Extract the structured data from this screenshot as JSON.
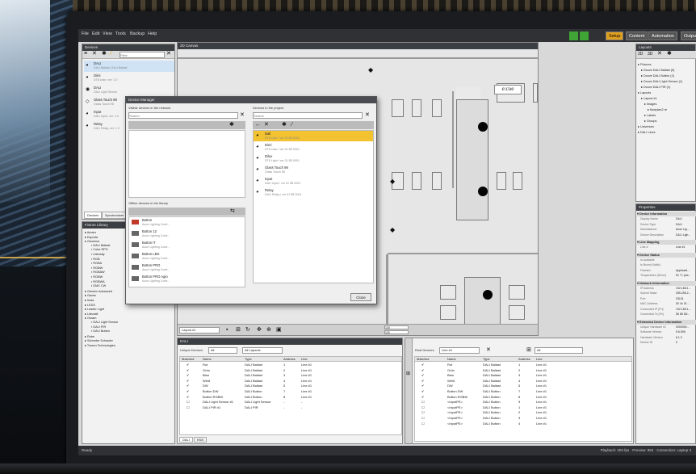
{
  "menu": [
    "File",
    "Edit",
    "View",
    "Tools",
    "Backup",
    "Help"
  ],
  "main_tabs": [
    "Setup",
    "Content",
    "Automation",
    "Output"
  ],
  "devices_panel": {
    "title": "Devices",
    "search_placeholder": "Filter",
    "items": [
      {
        "name": "DALI",
        "sub": "DALI Ballast, DALI Ballast"
      },
      {
        "name": "Dimi",
        "sub": "DT8 color, ver: 1.0"
      },
      {
        "name": "DALI",
        "sub": "DALI Light Sensor"
      },
      {
        "name": "Glass Touch 98",
        "sub": "Glass Touch 98"
      },
      {
        "name": "Input",
        "sub": "DALI Input, ver: 1.0"
      },
      {
        "name": "Relay",
        "sub": "DALI Relay, ver: 1.0"
      }
    ],
    "count": "5 of 5 sel",
    "tabs": [
      "Devices",
      "Synchronizer"
    ]
  },
  "fixture_library": {
    "title": "Fixture Library",
    "items": [
      "Amaru",
      "Esporta",
      "Generics",
      "DALI Ballast",
      "Color RPG",
      "Intensity",
      "RGB",
      "RGBA",
      "RGBW",
      "RGBAW",
      "RGBW",
      "RGBWA",
      "DMX CW",
      "Generic Advanced",
      "Gaxes",
      "Insta",
      "LEDS",
      "Leader Light",
      "Litecraft",
      "Osram",
      "DALI Light Sensor",
      "DALI PIR",
      "DALI Button",
      "Robe",
      "Schreder Schrader",
      "Traxon Technologies"
    ]
  },
  "canvas": {
    "title": "2D Canvas",
    "brand_label": "e:cue",
    "layout_select": "Layout #1",
    "zoom_a": "100",
    "zoom_b": "100"
  },
  "device_manager": {
    "title": "Device Manager",
    "visible_label": "Visible devices in the network",
    "project_label": "Devices in the project",
    "search_placeholder": "Search",
    "project_items": [
      {
        "name": "Dali",
        "sub": "DT8 color / ver 01 5B 0001"
      },
      {
        "name": "Dimi",
        "sub": "DT8 color / ver 01 5B 0001"
      },
      {
        "name": "Dilux",
        "sub": "DT8 Light / ver 01 5B 0001"
      },
      {
        "name": "Glass Touch 98",
        "sub": "Glass Touch 98"
      },
      {
        "name": "Input",
        "sub": "DALI Input / ver 01 5B 0001"
      },
      {
        "name": "Relay",
        "sub": "DALI Relay / ver 01 5B 0001"
      }
    ],
    "offline_label": "Offline devices in the library",
    "offline_items": [
      {
        "name": "Button",
        "sub": "Acue Lighting Contr..."
      },
      {
        "name": "Button 12",
        "sub": "Acue Lighting Contr..."
      },
      {
        "name": "Button IT",
        "sub": "Acue Lighting Contr..."
      },
      {
        "name": "Button LED",
        "sub": "Acue Lighting Contr..."
      },
      {
        "name": "Button PRO",
        "sub": "Acue Lighting Contr..."
      },
      {
        "name": "Button PRO Agio",
        "sub": "Acue Lighting Contr..."
      }
    ],
    "close_label": "Close"
  },
  "layouts_panel": {
    "title": "Layouts",
    "items": [
      "Fixtures",
      "Dcove DALI Ballast (5)",
      "Dcove DALI Button (2)",
      "Dcove DALI Light Sensor (1)",
      "Dcove DALI PIR (1)",
      "Layouts",
      "Layout #1",
      "Images",
      "floorplan2.re",
      "Labels",
      "Groups",
      "Universes",
      "DALI Lines"
    ]
  },
  "properties": {
    "title": "Properties",
    "sections": [
      {
        "header": "Device Information",
        "rows": [
          [
            "Display Name",
            "DALI"
          ],
          [
            "Device Type",
            "DALI"
          ],
          [
            "Manufacturer",
            "Acue Lig..."
          ],
          [
            "Device Description",
            "DALI Ligh..."
          ]
        ]
      },
      {
        "header": "Line Mapping",
        "rows": [
          [
            "Line #",
            "Line #1"
          ]
        ]
      },
      {
        "header": "Device Status",
        "rows": [
          [
            "Is Available",
            ""
          ],
          [
            "Is Bound (Valid)",
            ""
          ],
          [
            "Flashed",
            "Applicabl..."
          ],
          [
            "Temperature (Driver)",
            "51 °C (wa..."
          ]
        ]
      },
      {
        "header": "Network Information",
        "rows": [
          [
            "IP Address",
            "192.168.1..."
          ],
          [
            "Subnet Mask",
            "255.255.2..."
          ],
          [
            "Port",
            "33101"
          ],
          [
            "MAC Address",
            "00 1b 31..."
          ],
          [
            "Connected IP (Pri)",
            "192.168.1..."
          ],
          [
            "Connected To (Pri)",
            "Dli 85 6D..."
          ]
        ]
      },
      {
        "header": "Extended Device Information",
        "rows": [
          [
            "Unique Hardware ID",
            "0000000..."
          ],
          [
            "Software Version",
            "5.6.506"
          ],
          [
            "Hardware Version",
            "6.1.0"
          ],
          [
            "Device ID",
            "0"
          ]
        ]
      }
    ]
  },
  "dali_panel": {
    "title": "DALI",
    "unique_devices_label": "Unique Devices",
    "unique_devices_value": "All",
    "layouts_value": "All Layouts",
    "columns": [
      "Matched",
      "Name",
      "Type",
      "Address",
      "Line"
    ],
    "rows": [
      [
        "✔",
        "Rot",
        "DALI Ballast",
        "1",
        "Line #1"
      ],
      [
        "✔",
        "Grün",
        "DALI Ballast",
        "2",
        "Line #1"
      ],
      [
        "✔",
        "Blau",
        "DALI Ballast",
        "3",
        "Line #1"
      ],
      [
        "✔",
        "Weiß",
        "DALI Ballast",
        "4",
        "Line #1"
      ],
      [
        "✔",
        "DW",
        "DALI Ballast",
        "5",
        "Line #1"
      ],
      [
        "✔",
        "Button DW",
        "DALI Button",
        "7",
        "Line #1"
      ],
      [
        "✔",
        "Button RGBW",
        "DALI Button",
        "8",
        "Line #1"
      ],
      [
        "☐",
        "DALI Light Sensor #1",
        "DALI Light Sensor",
        "-",
        "-"
      ],
      [
        "☐",
        "DALI PIR #1",
        "DALI PIR",
        "-",
        "-"
      ]
    ],
    "bottom_tabs": [
      "DALI",
      "KNX"
    ]
  },
  "real_devices": {
    "label": "Real Devices",
    "line_value": "Line #1",
    "filter_value": "All",
    "columns": [
      "Matched",
      "Name",
      "Type",
      "Address",
      "Line"
    ],
    "rows": [
      [
        "✔",
        "Rot",
        "DALI Ballast",
        "1",
        "Line #1"
      ],
      [
        "✔",
        "Grün",
        "DALI Ballast",
        "2",
        "Line #1"
      ],
      [
        "✔",
        "Blau",
        "DALI Ballast",
        "3",
        "Line #1"
      ],
      [
        "✔",
        "Weiß",
        "DALI Ballast",
        "4",
        "Line #1"
      ],
      [
        "✔",
        "DW",
        "DALI Ballast",
        "5",
        "Line #1"
      ],
      [
        "✔",
        "Button DW",
        "DALI Button",
        "7",
        "Line #1"
      ],
      [
        "✔",
        "Button RGBW",
        "DALI Button",
        "8",
        "Line #1"
      ],
      [
        "☐",
        "<InputPE>",
        "DALI Button",
        "9",
        "Line #1"
      ],
      [
        "☐",
        "<InputPE>",
        "DALI Button",
        "1",
        "Line #1"
      ],
      [
        "☐",
        "<InputPE>",
        "DALI Button",
        "2",
        "Line #1"
      ],
      [
        "☐",
        "<InputPE>",
        "DALI Button",
        "3",
        "Line #1"
      ],
      [
        "☐",
        "<InputPE>",
        "DALI Button",
        "4",
        "Line #1"
      ]
    ]
  },
  "status": {
    "left": "Ready",
    "right": "Playback: 303 fps · Preview: 853 · Connection: Laptop 3"
  },
  "colors": {
    "accent": "#e0a020",
    "selection": "#f2c230",
    "dark": "#2f3134"
  }
}
